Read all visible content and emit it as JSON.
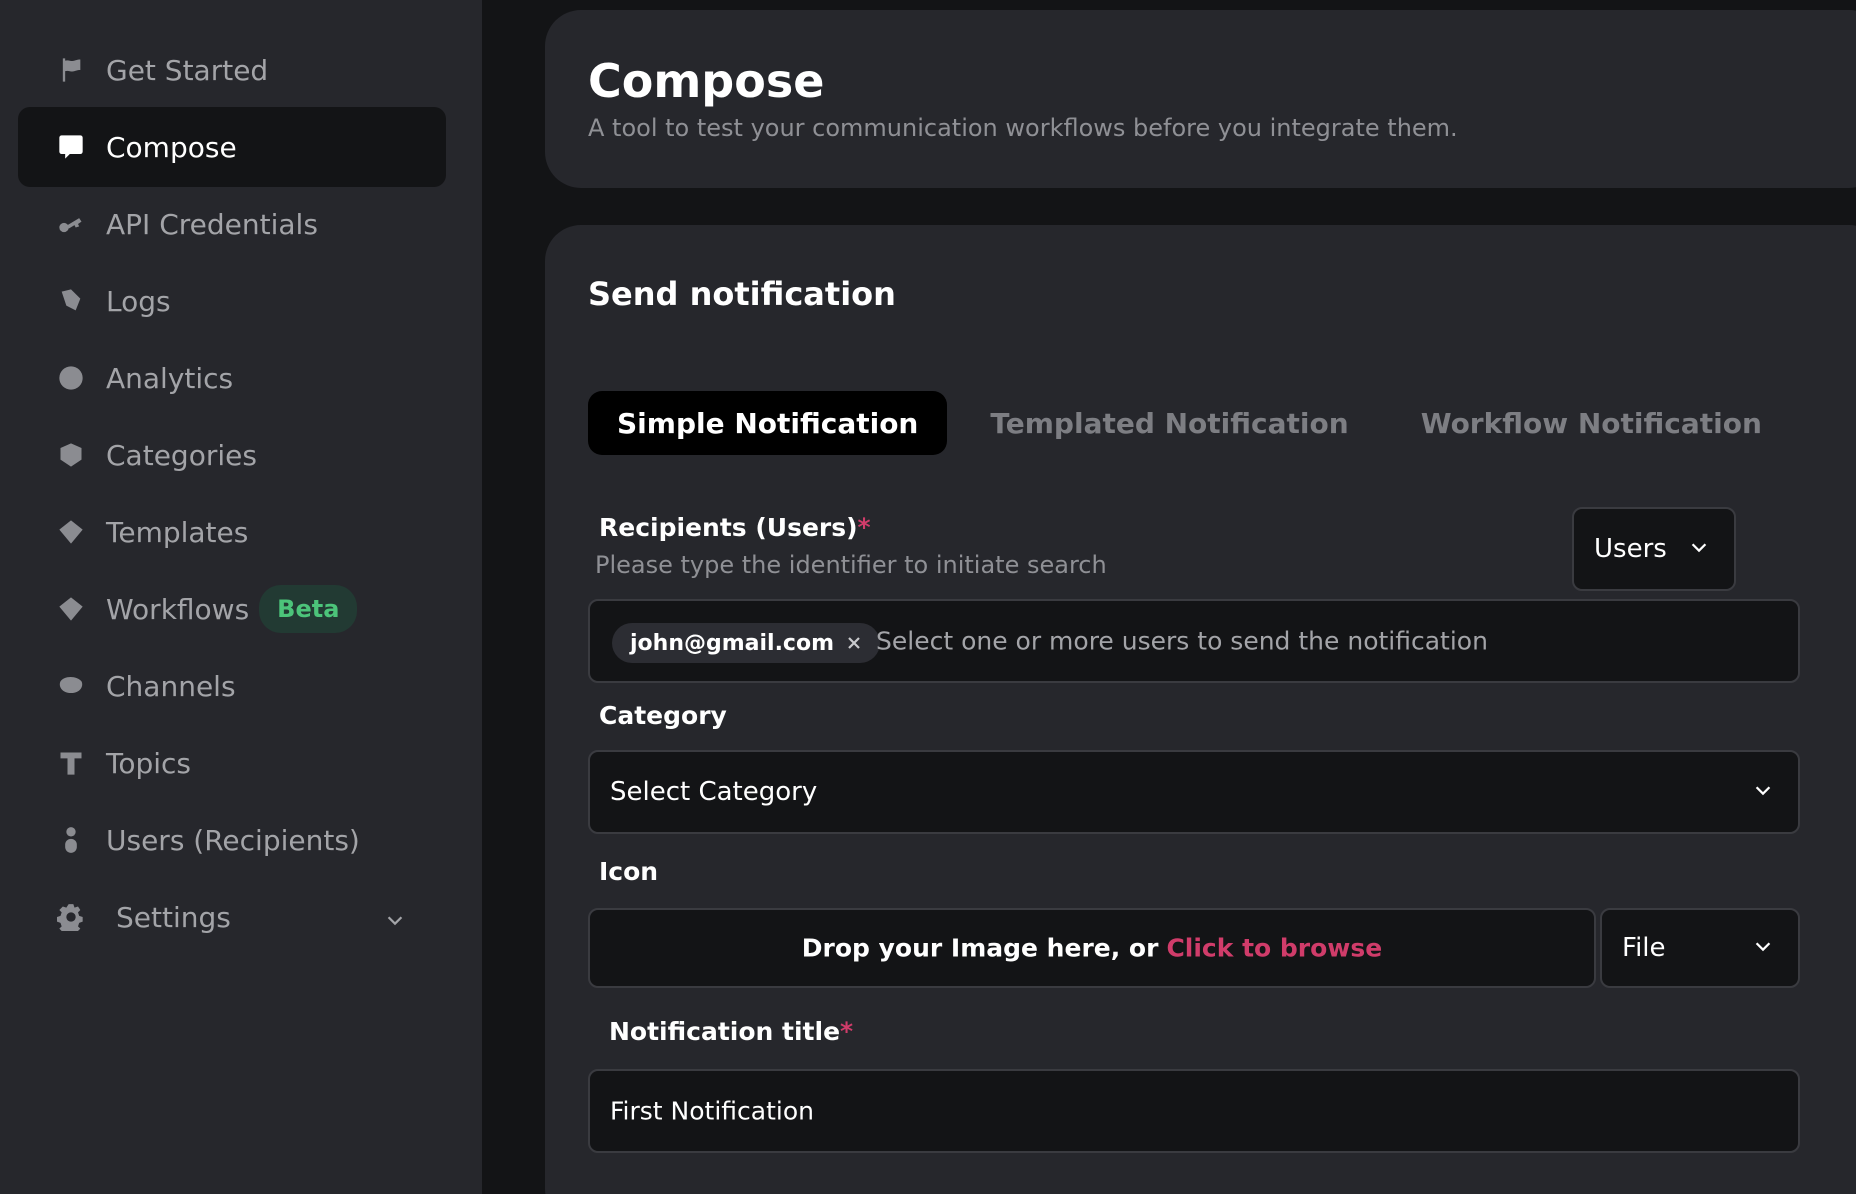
{
  "sidebar": {
    "items": [
      {
        "label": "Get Started",
        "icon": "flag-icon"
      },
      {
        "label": "Compose",
        "icon": "message-icon",
        "active": true
      },
      {
        "label": "API Credentials",
        "icon": "key-icon"
      },
      {
        "label": "Logs",
        "icon": "logs-icon"
      },
      {
        "label": "Analytics",
        "icon": "analytics-icon"
      },
      {
        "label": "Categories",
        "icon": "categories-icon"
      },
      {
        "label": "Templates",
        "icon": "templates-icon"
      },
      {
        "label": "Workflows",
        "icon": "workflows-icon",
        "badge": "Beta"
      },
      {
        "label": "Channels",
        "icon": "channels-icon"
      },
      {
        "label": "Topics",
        "icon": "topics-icon"
      },
      {
        "label": "Users (Recipients)",
        "icon": "user-icon"
      },
      {
        "label": "Settings",
        "icon": "gear-icon"
      }
    ]
  },
  "header": {
    "title": "Compose",
    "subtitle": "A tool to test your communication workflows before you integrate them."
  },
  "form": {
    "title": "Send notification",
    "tabs": [
      "Simple Notification",
      "Templated Notification",
      "Workflow Notification"
    ],
    "recipients": {
      "label": "Recipients (Users)",
      "required": "*",
      "hint": "Please type the identifier to initiate search",
      "type_select": "Users",
      "chip": "john@gmail.com",
      "placeholder": "Select one or more users to send the notification"
    },
    "category": {
      "label": "Category",
      "value": "Select Category"
    },
    "icon_field": {
      "label": "Icon",
      "drop_text": "Drop your Image here, or",
      "browse_text": "Click to browse",
      "type_select": "File"
    },
    "notification_title": {
      "label": "Notification title",
      "required": "*",
      "value": "First Notification"
    }
  },
  "colors": {
    "accent": "#d03c6a",
    "badge_text": "#4cc47a",
    "background": "#131416",
    "panel": "#26272c"
  }
}
